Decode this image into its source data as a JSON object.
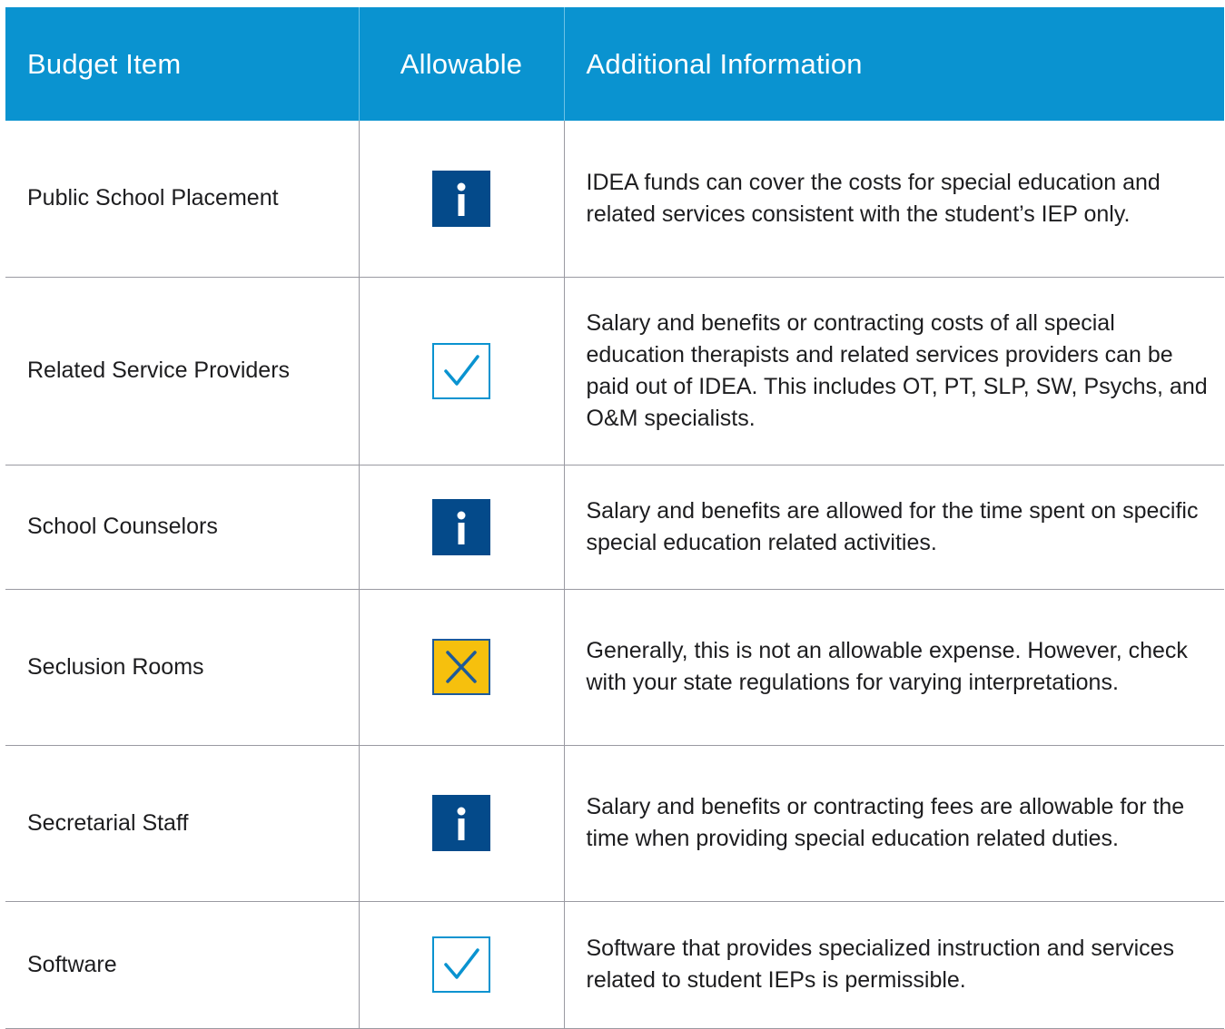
{
  "headers": {
    "item": "Budget Item",
    "allowable": "Allowable",
    "info": "Additional Information"
  },
  "colors": {
    "header_bg": "#0a93d0",
    "info_badge": "#044a8a",
    "check_badge": "#0a93d0",
    "x_badge_fill": "#f6c00d",
    "x_badge_mark": "#1e5a9a"
  },
  "rows": [
    {
      "item": "Public School Placement",
      "status": "info-icon",
      "info": "IDEA funds can cover the costs for special education and related services consistent with the student’s IEP only."
    },
    {
      "item": "Related Service Providers",
      "status": "checkmark-icon",
      "info": "Salary and benefits or contracting costs of all special education therapists and related services providers can be paid out of IDEA. This includes OT, PT, SLP, SW, Psychs, and O&M specialists."
    },
    {
      "item": "School Counselors",
      "status": "info-icon",
      "info": "Salary and benefits are allowed for the time spent on specific special education related activities."
    },
    {
      "item": "Seclusion Rooms",
      "status": "x-icon",
      "info": "Generally, this is not an allowable expense. However, check with your state regulations for varying interpretations."
    },
    {
      "item": "Secretarial Staff",
      "status": "info-icon",
      "info": "Salary and benefits or contracting fees are allowable for the time when providing special education related duties."
    },
    {
      "item": "Software",
      "status": "checkmark-icon",
      "info": "Software that provides specialized instruction and services related to student IEPs is permissible."
    }
  ]
}
